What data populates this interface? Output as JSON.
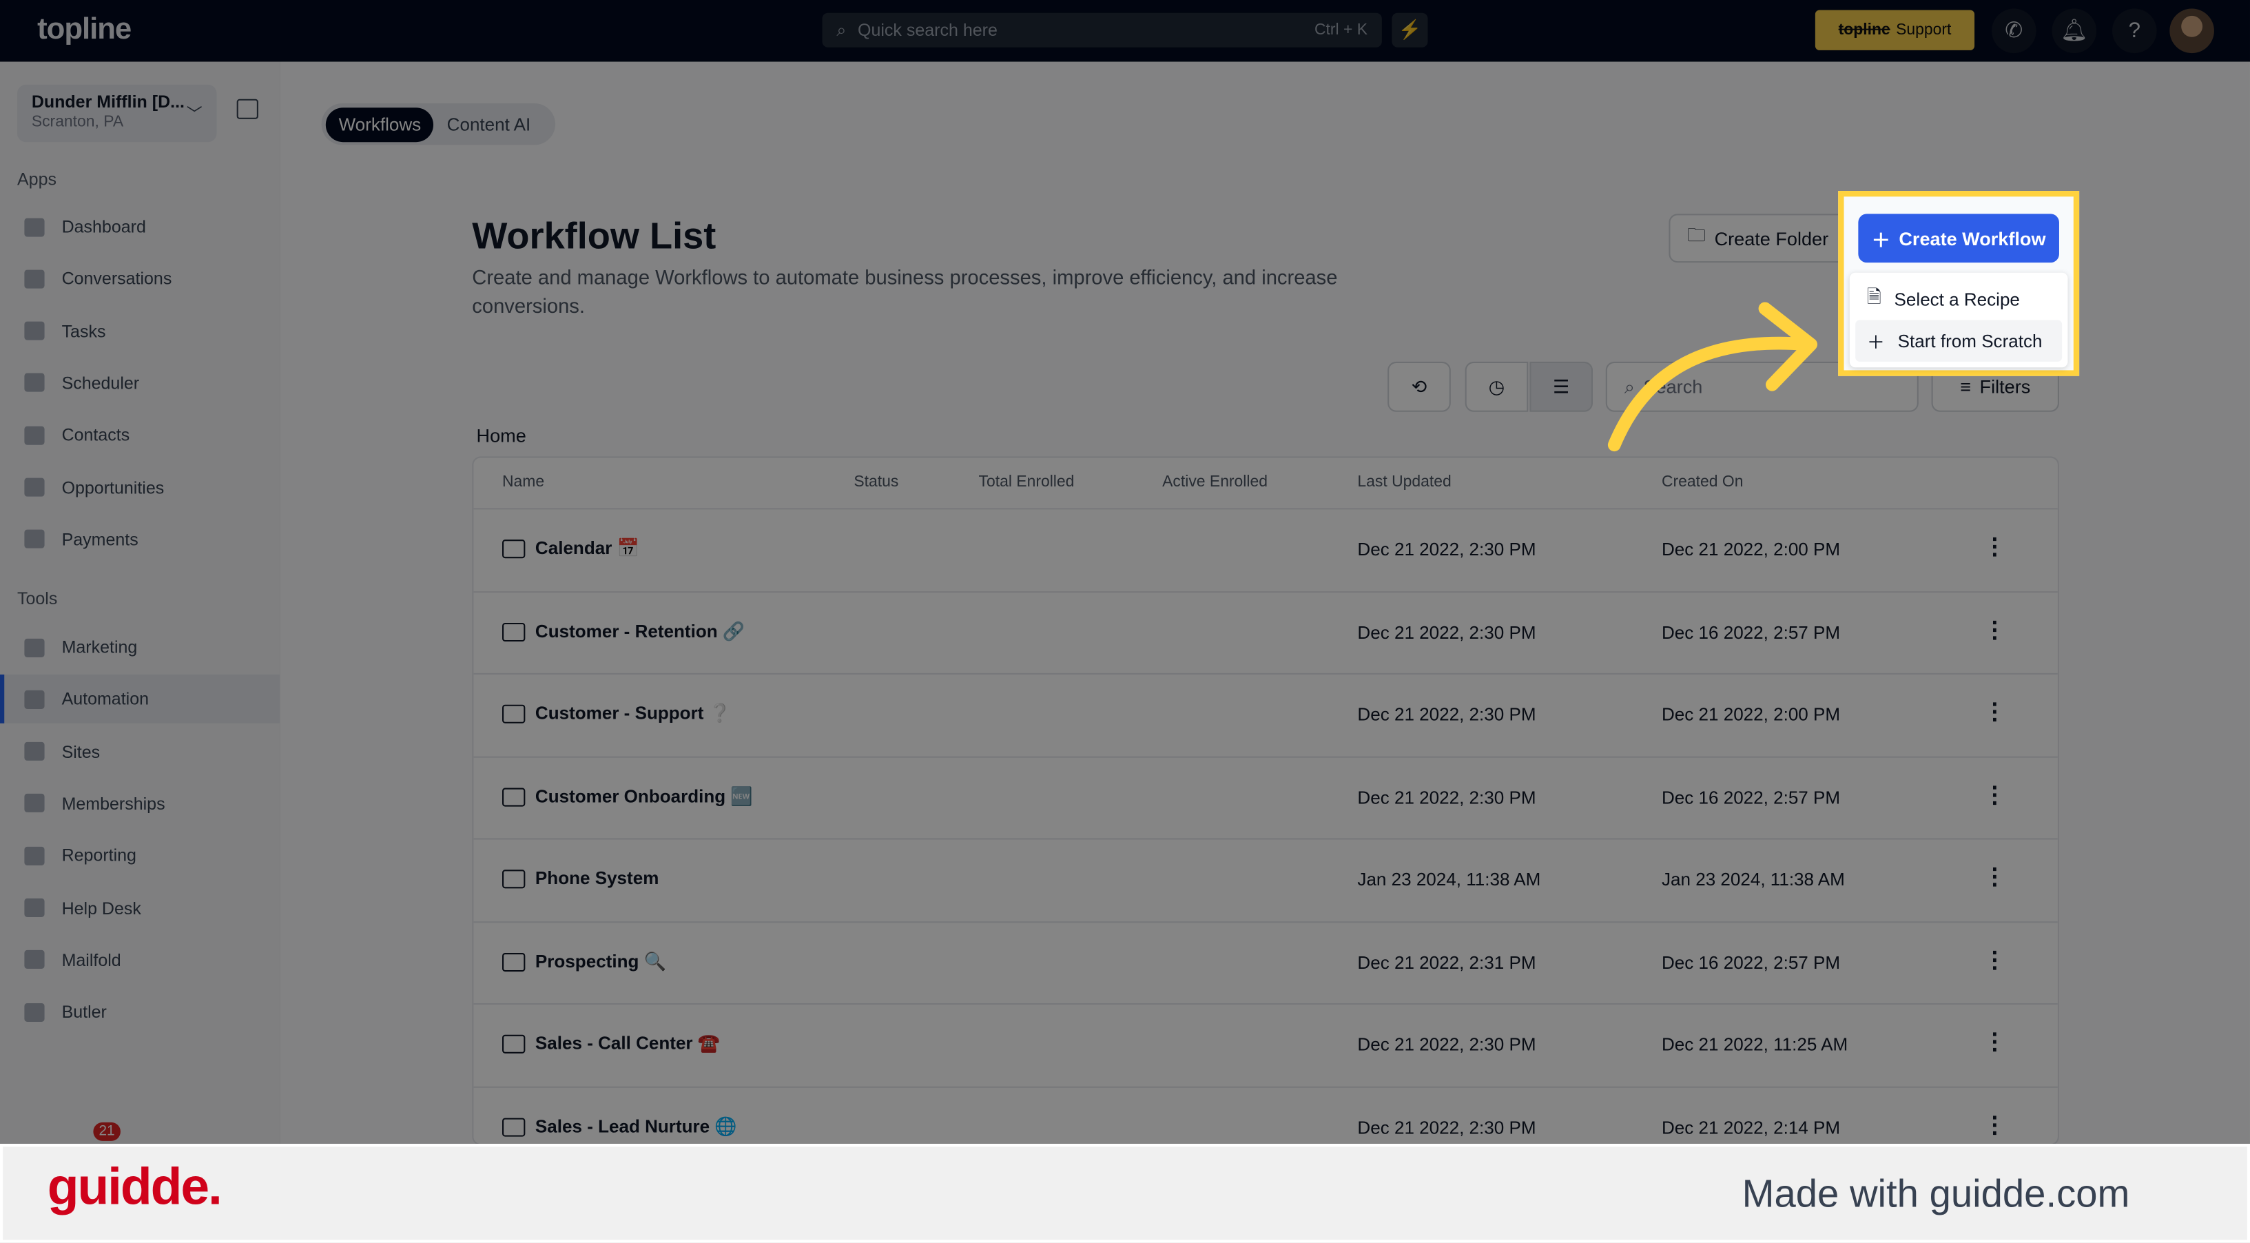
{
  "header": {
    "logo": "topline",
    "search_placeholder": "Quick search here",
    "search_shortcut": "Ctrl + K",
    "support_brand": "topline",
    "support_label": "Support"
  },
  "sidebar": {
    "account_name": "Dunder Mifflin [D...",
    "account_location": "Scranton, PA",
    "apps_label": "Apps",
    "tools_label": "Tools",
    "apps": [
      "Dashboard",
      "Conversations",
      "Tasks",
      "Scheduler",
      "Contacts",
      "Opportunities",
      "Payments"
    ],
    "tools": [
      "Marketing",
      "Automation",
      "Sites",
      "Memberships",
      "Reporting",
      "Help Desk",
      "Mailfold",
      "Butler"
    ],
    "active": "Automation",
    "notification_count": "21"
  },
  "tabs": [
    "Workflows",
    "Content AI"
  ],
  "page": {
    "title": "Workflow List",
    "description": "Create and manage Workflows to automate business processes, improve efficiency, and increase conversions.",
    "create_folder": "Create Folder",
    "create_workflow": "Create Workflow",
    "search_placeholder": "Search",
    "filters": "Filters",
    "breadcrumb": "Home"
  },
  "dropdown": [
    "Select a Recipe",
    "Start from Scratch"
  ],
  "table": {
    "columns": [
      "Name",
      "Status",
      "Total Enrolled",
      "Active Enrolled",
      "Last Updated",
      "Created On"
    ],
    "rows": [
      {
        "name": "Calendar 📅",
        "updated": "Dec 21 2022, 2:30 PM",
        "created": "Dec 21 2022, 2:00 PM"
      },
      {
        "name": "Customer - Retention 🔗",
        "updated": "Dec 21 2022, 2:30 PM",
        "created": "Dec 16 2022, 2:57 PM"
      },
      {
        "name": "Customer - Support ❔",
        "updated": "Dec 21 2022, 2:30 PM",
        "created": "Dec 21 2022, 2:00 PM"
      },
      {
        "name": "Customer Onboarding 🆕",
        "updated": "Dec 21 2022, 2:30 PM",
        "created": "Dec 16 2022, 2:57 PM"
      },
      {
        "name": "Phone System",
        "updated": "Jan 23 2024, 11:38 AM",
        "created": "Jan 23 2024, 11:38 AM"
      },
      {
        "name": "Prospecting 🔍",
        "updated": "Dec 21 2022, 2:31 PM",
        "created": "Dec 16 2022, 2:57 PM"
      },
      {
        "name": "Sales - Call Center ☎️",
        "updated": "Dec 21 2022, 2:30 PM",
        "created": "Dec 21 2022, 11:25 AM"
      },
      {
        "name": "Sales - Lead Nurture 🌐",
        "updated": "Dec 21 2022, 2:30 PM",
        "created": "Dec 21 2022, 2:14 PM"
      }
    ]
  },
  "footer": {
    "logo": "guidde.",
    "made_with": "Made with guidde.com"
  },
  "colors": {
    "highlight": "#ffd23f",
    "primary": "#2f5ee8",
    "header": "#020a1f"
  }
}
